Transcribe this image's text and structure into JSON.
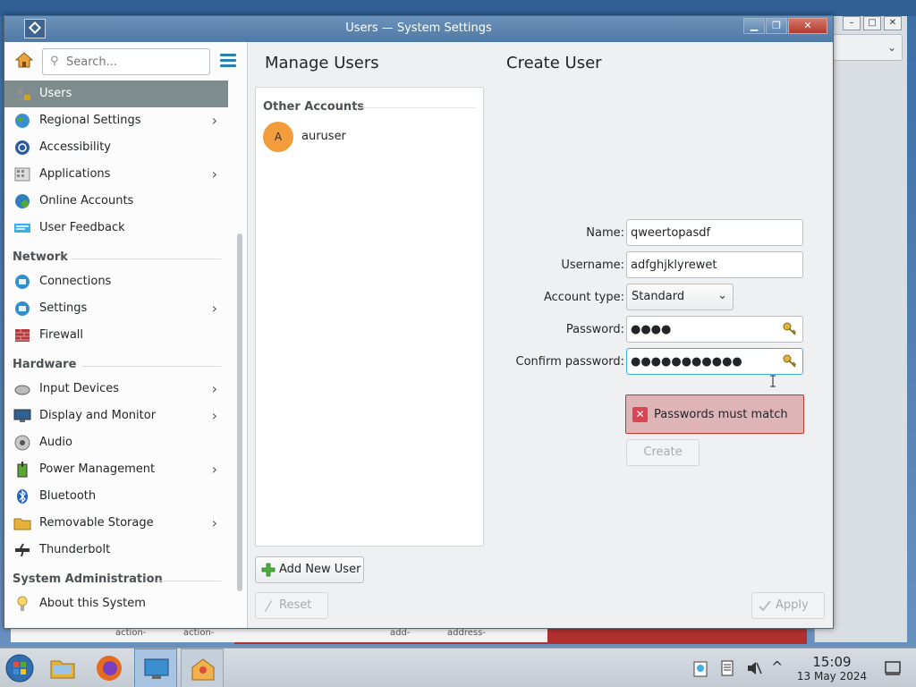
{
  "window": {
    "title": "Users — System Settings"
  },
  "sidebar": {
    "search_placeholder": "Search...",
    "items_top": [
      {
        "label": "Users",
        "icon": "users-icon",
        "chevron": false,
        "active": true
      },
      {
        "label": "Regional Settings",
        "icon": "globe-icon",
        "chevron": true
      },
      {
        "label": "Accessibility",
        "icon": "accessibility-icon",
        "chevron": false
      },
      {
        "label": "Applications",
        "icon": "applications-icon",
        "chevron": true
      },
      {
        "label": "Online Accounts",
        "icon": "online-accounts-icon",
        "chevron": false
      },
      {
        "label": "User Feedback",
        "icon": "feedback-icon",
        "chevron": false
      }
    ],
    "section_network": "Network",
    "items_network": [
      {
        "label": "Connections",
        "icon": "network-icon",
        "chevron": false
      },
      {
        "label": "Settings",
        "icon": "network-settings-icon",
        "chevron": true
      },
      {
        "label": "Firewall",
        "icon": "firewall-icon",
        "chevron": false
      }
    ],
    "section_hardware": "Hardware",
    "items_hardware": [
      {
        "label": "Input Devices",
        "icon": "mouse-icon",
        "chevron": true
      },
      {
        "label": "Display and Monitor",
        "icon": "monitor-icon",
        "chevron": true
      },
      {
        "label": "Audio",
        "icon": "speaker-icon",
        "chevron": false
      },
      {
        "label": "Power Management",
        "icon": "power-icon",
        "chevron": true
      },
      {
        "label": "Bluetooth",
        "icon": "bluetooth-icon",
        "chevron": false
      },
      {
        "label": "Removable Storage",
        "icon": "folder-icon",
        "chevron": true
      },
      {
        "label": "Thunderbolt",
        "icon": "thunderbolt-icon",
        "chevron": false
      }
    ],
    "section_sysadmin": "System Administration",
    "items_sysadmin": [
      {
        "label": "About this System",
        "icon": "about-icon",
        "chevron": false
      }
    ]
  },
  "main": {
    "page_title": "Manage Users",
    "panel_title": "Create User",
    "accounts_header": "Other Accounts",
    "accounts": [
      {
        "initial": "A",
        "name": "auruser"
      }
    ],
    "add_user_label": "Add New User",
    "reset_label": "Reset",
    "apply_label": "Apply"
  },
  "form": {
    "name_label": "Name:",
    "name_value": "qweertopasdf",
    "username_label": "Username:",
    "username_value": "adfghjklyrewet",
    "account_type_label": "Account type:",
    "account_type_value": "Standard",
    "password_label": "Password:",
    "password_value": "●●●●",
    "confirm_label": "Confirm password:",
    "confirm_value": "●●●●●●●●●●●",
    "error_message": "Passwords must match",
    "create_label": "Create"
  },
  "taskbar": {
    "time": "15:09",
    "date": "13 May 2024"
  },
  "background": {
    "lower_labels": [
      "action-",
      "action-",
      "add-",
      "address-"
    ]
  },
  "colors": {
    "sidebar_active": "#7f8c8d",
    "accent": "#2980b9",
    "error_bg": "#dfb4b7",
    "avatar": "#f39c3c",
    "titlebar": "#4f79a6"
  }
}
